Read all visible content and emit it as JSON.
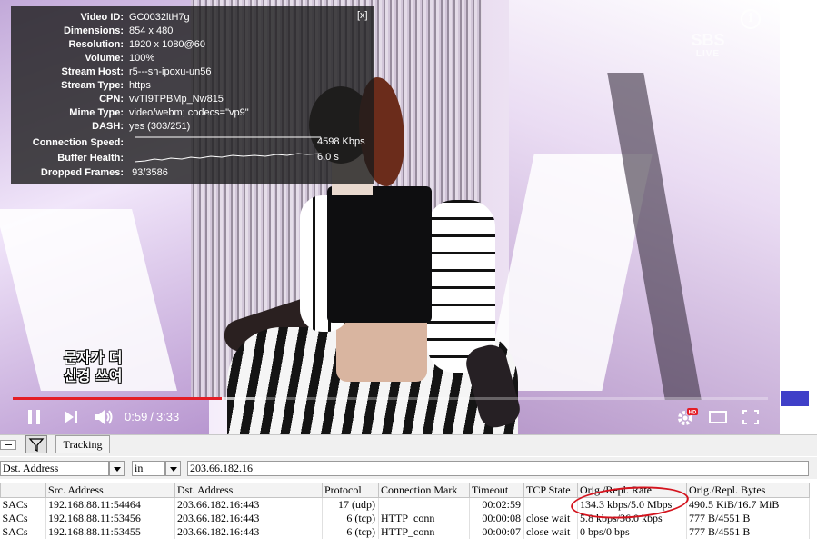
{
  "stats": {
    "close_label": "[x]",
    "rows": [
      {
        "key": "Video ID:",
        "value": "GC0032ltH7g"
      },
      {
        "key": "Dimensions:",
        "value": "854 x 480"
      },
      {
        "key": "Resolution:",
        "value": "1920 x 1080@60"
      },
      {
        "key": "Volume:",
        "value": "100%"
      },
      {
        "key": "Stream Host:",
        "value": "r5---sn-ipoxu-un56"
      },
      {
        "key": "Stream Type:",
        "value": "https"
      },
      {
        "key": "CPN:",
        "value": "vvTI9TPBMp_Nw815"
      },
      {
        "key": "Mime Type:",
        "value": "video/webm; codecs=\"vp9\""
      },
      {
        "key": "DASH:",
        "value": "yes (303/251)"
      }
    ],
    "connection_speed": {
      "key": "Connection Speed:",
      "value": "4598 Kbps"
    },
    "buffer_health": {
      "key": "Buffer Health:",
      "value": "6.0 s"
    },
    "dropped_frames": {
      "key": "Dropped Frames:",
      "value": "93/3586"
    }
  },
  "overlay": {
    "broadcaster_logo": "SBS",
    "broadcaster_sub": "LIVE",
    "info_icon": "i",
    "subtitle_line1": "문자가 더",
    "subtitle_line2": "신경 쓰여"
  },
  "player": {
    "current_time": "0:59",
    "time_separator": "/",
    "duration": "3:33",
    "progress_fraction": 0.277,
    "buffered_fraction": 0.33,
    "icons": {
      "play": "play-pause-icon",
      "next": "next-icon",
      "volume": "volume-icon",
      "settings": "settings-icon",
      "hd_badge": "HD",
      "theater": "theater-mode-icon",
      "fullscreen": "fullscreen-icon"
    },
    "accent_color": "#e41e26"
  },
  "winbox": {
    "tracking_label": "Tracking",
    "filter": {
      "field": "Dst. Address",
      "operator": "in",
      "value": "203.66.182.16"
    },
    "columns": [
      "",
      "Src. Address",
      "Dst. Address",
      "Protocol",
      "Connection Mark",
      "Timeout",
      "TCP State",
      "Orig./Repl. Rate",
      "Orig./Repl. Bytes"
    ],
    "rows": [
      [
        "SACs",
        "192.168.88.11:54464",
        "203.66.182.16:443",
        "17 (udp)",
        "",
        "00:02:59",
        "",
        "134.3 kbps/5.0 Mbps",
        "490.5 KiB/16.7 MiB"
      ],
      [
        "SACs",
        "192.168.88.11:53456",
        "203.66.182.16:443",
        "6 (tcp)",
        "HTTP_conn",
        "00:00:08",
        "close wait",
        "5.8 kbps/36.0 kbps",
        "777 B/4551 B"
      ],
      [
        "SACs",
        "192.168.88.11:53455",
        "203.66.182.16:443",
        "6 (tcp)",
        "HTTP_conn",
        "00:00:07",
        "close wait",
        "0 bps/0 bps",
        "777 B/4551 B"
      ]
    ]
  }
}
